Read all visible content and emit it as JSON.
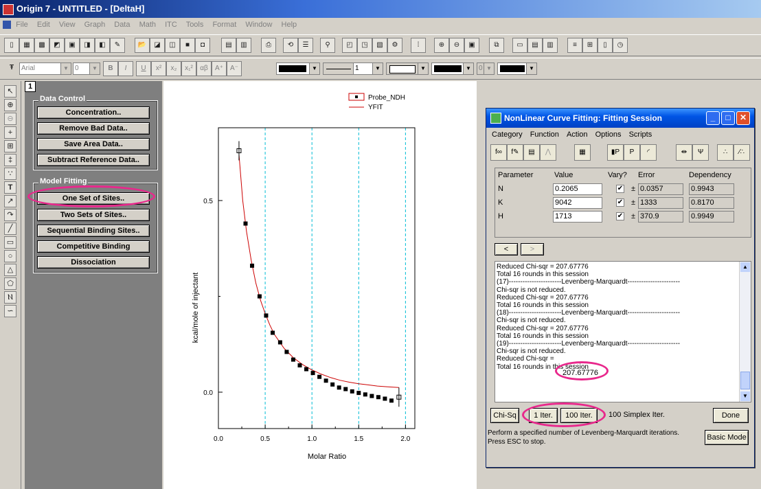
{
  "app": {
    "title": "Origin 7 - UNTITLED - [DeltaH]"
  },
  "menu": [
    "File",
    "Edit",
    "View",
    "Graph",
    "Data",
    "Math",
    "ITC",
    "Tools",
    "Format",
    "Window",
    "Help"
  ],
  "format_bar": {
    "font": "Arial",
    "size": "0",
    "line_width": "1",
    "bold_label": "B",
    "italic_label": "I",
    "underline_label": "U",
    "sup_label": "x²",
    "sub_label": "x₂",
    "supsub_label": "x₁²",
    "greek_label": "αβ",
    "grow_label": "A⁺",
    "shrink_label": "A⁻",
    "fill_value": "0"
  },
  "layer": {
    "number": "1"
  },
  "data_control": {
    "label": "Data Control",
    "buttons": [
      "Concentration..",
      "Remove Bad Data..",
      "Save Area Data..",
      "Subtract Reference Data.."
    ]
  },
  "model_fitting": {
    "label": "Model Fitting",
    "buttons": [
      "One Set of Sites..",
      "Two Sets of Sites..",
      "Sequential Binding Sites..",
      "Competitive Binding",
      "Dissociation"
    ]
  },
  "chart_data": {
    "type": "scatter",
    "xlabel": "Molar Ratio",
    "ylabel": "kcal/mole of injectant",
    "xlim": [
      0,
      2.1
    ],
    "ylim": [
      -0.095,
      0.69
    ],
    "xticks": [
      "0.0",
      "0.5",
      "1.0",
      "1.5",
      "2.0"
    ],
    "yticks": [
      "0.0",
      "0.5"
    ],
    "legend": {
      "position": "top-right",
      "entries": [
        "Probe_NDH",
        "YFIT"
      ]
    },
    "series": [
      {
        "name": "Probe_NDH",
        "kind": "points",
        "color": "#000000",
        "x": [
          0.22,
          0.29,
          0.36,
          0.44,
          0.51,
          0.58,
          0.66,
          0.73,
          0.8,
          0.87,
          0.94,
          1.01,
          1.08,
          1.15,
          1.22,
          1.29,
          1.36,
          1.43,
          1.5,
          1.57,
          1.64,
          1.71,
          1.78,
          1.85,
          1.93
        ],
        "y": [
          0.63,
          0.44,
          0.33,
          0.25,
          0.2,
          0.155,
          0.13,
          0.105,
          0.085,
          0.07,
          0.06,
          0.05,
          0.04,
          0.03,
          0.02,
          0.012,
          0.008,
          0.002,
          -0.002,
          -0.006,
          -0.01,
          -0.013,
          -0.017,
          -0.022,
          -0.013
        ]
      },
      {
        "name": "YFIT",
        "kind": "line",
        "color": "#cc0000",
        "x": [
          0.22,
          0.26,
          0.3,
          0.35,
          0.4,
          0.45,
          0.5,
          0.55,
          0.6,
          0.7,
          0.8,
          0.9,
          1.0,
          1.1,
          1.2,
          1.3,
          1.4,
          1.5,
          1.6,
          1.7,
          1.8,
          1.93
        ],
        "y": [
          0.62,
          0.5,
          0.42,
          0.345,
          0.285,
          0.24,
          0.205,
          0.175,
          0.15,
          0.115,
          0.09,
          0.072,
          0.058,
          0.047,
          0.038,
          0.031,
          0.026,
          0.022,
          0.019,
          0.016,
          0.014,
          0.012
        ]
      }
    ]
  },
  "fit_window": {
    "title": "NonLinear Curve Fitting: Fitting Session",
    "menu": [
      "Category",
      "Function",
      "Action",
      "Options",
      "Scripts"
    ],
    "headers": [
      "Parameter",
      "Value",
      "Vary?",
      "Error",
      "Dependency"
    ],
    "params": [
      {
        "name": "N",
        "value": "0.2065",
        "vary": "✔",
        "pm": "±",
        "error": "0.0357",
        "dependency": "0.9943"
      },
      {
        "name": "K",
        "value": "9042",
        "vary": "✔",
        "pm": "±",
        "error": "1333",
        "dependency": "0.8170"
      },
      {
        "name": "H",
        "value": "1713",
        "vary": "✔",
        "pm": "±",
        "error": "370.9",
        "dependency": "0.9949"
      }
    ],
    "log": [
      "Reduced Chi-sqr = 207.67776",
      "Total 16 rounds in this session",
      "(17)-----------------------Levenberg-Marquardt-----------------------",
      "Chi-sqr is not reduced.",
      "Reduced Chi-sqr = 207.67776",
      "Total 16 rounds in this session",
      "(18)-----------------------Levenberg-Marquardt-----------------------",
      "Chi-sqr is not reduced.",
      "Reduced Chi-sqr = 207.67776",
      "Total 16 rounds in this session",
      "(19)-----------------------Levenberg-Marquardt-----------------------",
      "Chi-sqr is not reduced.",
      "Reduced Chi-sqr =",
      "Total 16 rounds in this session"
    ],
    "highlight_value": "207.67776",
    "buttons": {
      "chisq": "Chi-Sq",
      "iter1": "1 Iter.",
      "iter100": "100 Iter.",
      "simplex": "100 Simplex Iter.",
      "done": "Done",
      "basic": "Basic Mode"
    },
    "hint": "Perform a specified number of Levenberg-Marquardt iterations. Press ESC to stop."
  }
}
